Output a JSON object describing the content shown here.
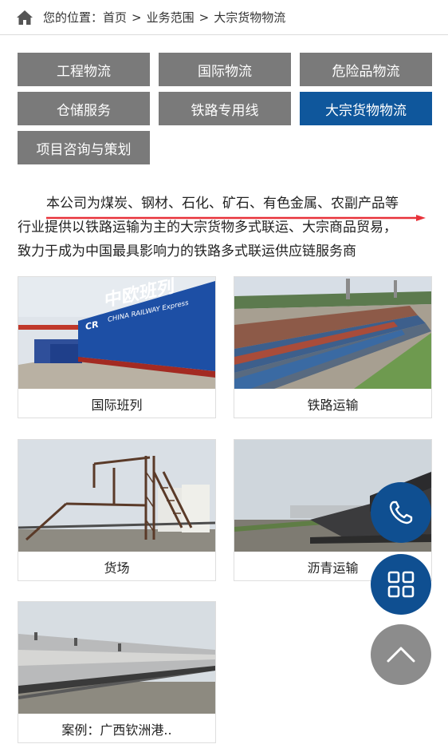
{
  "breadcrumb": {
    "prefix": "您的位置：",
    "home": "首页",
    "separator": ">",
    "section": "业务范围",
    "current": "大宗货物物流"
  },
  "categories": [
    {
      "label": "工程物流",
      "active": false
    },
    {
      "label": "国际物流",
      "active": false
    },
    {
      "label": "危险品物流",
      "active": false
    },
    {
      "label": "仓储服务",
      "active": false
    },
    {
      "label": "铁路专用线",
      "active": false
    },
    {
      "label": "大宗货物物流",
      "active": true
    },
    {
      "label": "项目咨询与策划",
      "active": false
    }
  ],
  "intro": {
    "line1": "本公司为煤炭、钢材、石化、矿石、有色金属、农副产品等",
    "line2": "行业提供以铁路运输为主的大宗货物多式联运、大宗商品贸易，",
    "line3": "致力于成为中国最具影响力的铁路多式联运供应链服务商"
  },
  "cards": [
    {
      "caption": "国际班列",
      "image_text": [
        "中欧班列",
        "CHINA RAILWAY Express",
        "CR"
      ]
    },
    {
      "caption": "铁路运输"
    },
    {
      "caption": "货场"
    },
    {
      "caption": "沥青运输"
    },
    {
      "caption": "案例：广西钦洲港.."
    }
  ],
  "fabs": [
    {
      "name": "phone-icon"
    },
    {
      "name": "grid-menu-icon"
    },
    {
      "name": "chevron-up-icon"
    }
  ],
  "colors": {
    "active_tab": "#0f579c",
    "inactive_tab": "#7a7a7a",
    "fab_blue": "#0f4f91",
    "fab_grey": "#8c8c8c",
    "underline_red": "#e8323a"
  }
}
